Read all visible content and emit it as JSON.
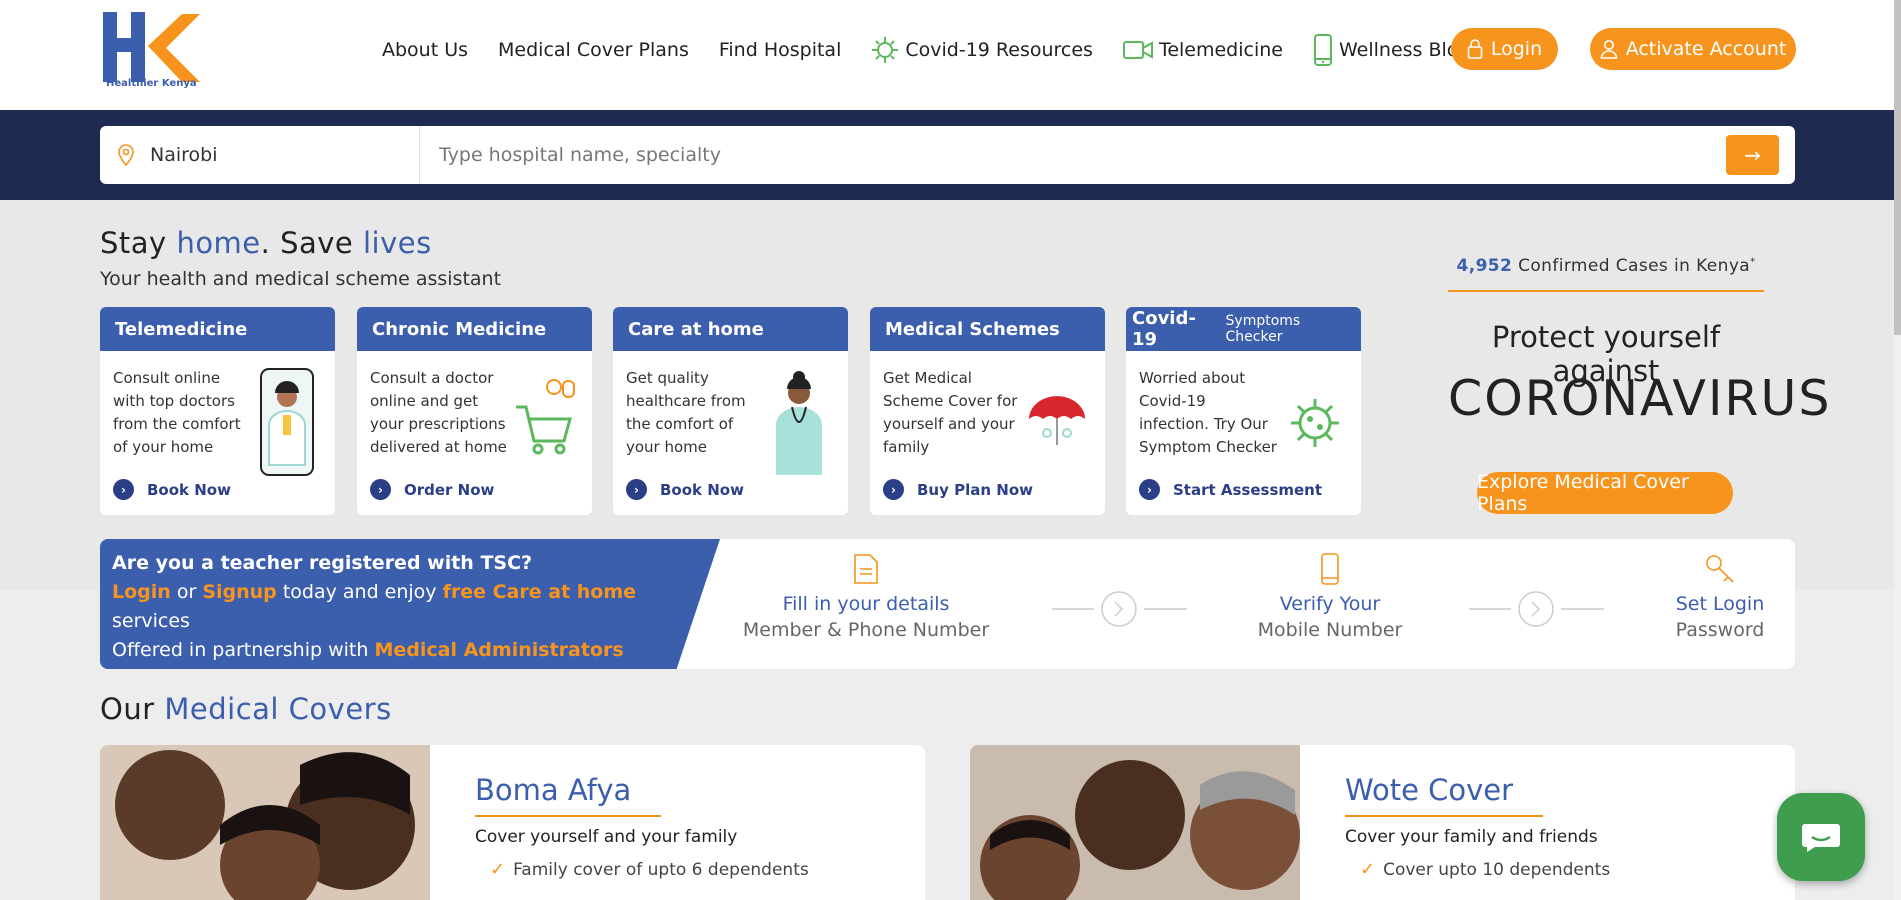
{
  "brand": {
    "logo_text": "Healthier Kenya",
    "orange": "#f7941d",
    "blue": "#3b5ead",
    "navy": "#1e2a4f"
  },
  "nav": {
    "about": "About Us",
    "plans": "Medical Cover Plans",
    "find": "Find Hospital",
    "covid": "Covid-19 Resources",
    "tele": "Telemedicine",
    "blog": "Wellness Blog",
    "login": "Login",
    "activate": "Activate Account"
  },
  "search": {
    "location": "Nairobi",
    "placeholder": "Type hospital name, specialty"
  },
  "hero": {
    "title_a": "Stay ",
    "title_b": "home",
    "title_c": ". Save ",
    "title_d": "lives",
    "subtitle": "Your health and medical scheme assistant"
  },
  "cards": [
    {
      "title": "Telemedicine",
      "body": "Consult online with top doctors from the comfort of your home",
      "link": "Book Now"
    },
    {
      "title": "Chronic Medicine",
      "body": "Consult a doctor online and get your prescriptions delivered at home",
      "link": "Order Now"
    },
    {
      "title": "Care at home",
      "body": "Get quality healthcare from the comfort of your home",
      "link": "Book Now"
    },
    {
      "title": "Medical Schemes",
      "body": "Get Medical Scheme Cover for yourself and your family",
      "link": "Buy Plan Now"
    },
    {
      "title": "Covid-19",
      "title_small": "Symptoms Checker",
      "body": "Worried about Covid-19 infection. Try Our Symptom Checker",
      "link": "Start Assessment"
    }
  ],
  "covid_panel": {
    "cases_count": "4,952",
    "cases_label": " Confirmed Cases in Kenya",
    "asterisk": "*",
    "protect": "Protect yourself against",
    "coronavirus": "CORONAVIRUS",
    "explore": "Explore Medical Cover Plans"
  },
  "tsc": {
    "question": "Are you a teacher registered with TSC?",
    "login": "Login",
    "or": " or ",
    "signup": "Signup",
    "today": " today and enjoy ",
    "free": "free Care at home",
    "services": " services",
    "partner": "Offered in partnership with ",
    "partner_name": "Medical Administrators Kenya Limited",
    "steps": [
      {
        "line1": "Fill in your details",
        "line2": "Member & Phone Number"
      },
      {
        "line1": "Verify Your",
        "line2": "Mobile Number"
      },
      {
        "line1": "Set Login",
        "line2": "Password"
      }
    ]
  },
  "covers": {
    "title_a": "Our ",
    "title_b": "Medical Covers",
    "items": [
      {
        "name": "Boma Afya",
        "desc": "Cover yourself and your family",
        "feature": "Family cover of upto 6 dependents"
      },
      {
        "name": "Wote Cover",
        "desc": "Cover your family and friends",
        "feature": "Cover upto 10 dependents"
      }
    ]
  }
}
